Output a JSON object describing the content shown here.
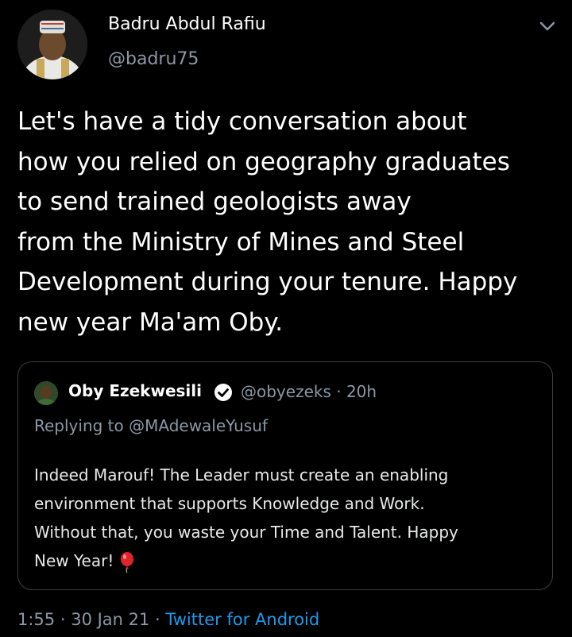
{
  "tweet": {
    "author": {
      "display_name": "Badru Abdul Rafiu",
      "handle": "@badru75"
    },
    "text_lines": [
      "Let's have a tidy conversation about",
      "how you relied on geography graduates",
      "to send trained geologists away",
      "from the Ministry of Mines and Steel",
      "Development during your tenure. Happy",
      "new year Ma'am Oby."
    ],
    "icons": {
      "menu": "chevron-down-icon",
      "verified": "verified-badge-icon",
      "emoji": "red-balloon-emoji"
    },
    "quoted": {
      "display_name": "Oby Ezekwesili",
      "handle_time": "@obyezeks · 20h",
      "replying_to": "Replying to @MAdewaleYusuf",
      "text_lines": [
        "Indeed Marouf! The Leader must create an enabling",
        "environment that supports Knowledge and Work.",
        "Without that, you waste your Time and Talent. Happy",
        "New Year!"
      ]
    },
    "meta": {
      "time": "1:55",
      "sep1": " · ",
      "date": "30 Jan 21",
      "sep2": " · ",
      "source": "Twitter for Android"
    },
    "colors": {
      "background": "#000000",
      "muted": "#8b98a5",
      "accent": "#1d9bf0",
      "border": "#3a3f44"
    }
  }
}
